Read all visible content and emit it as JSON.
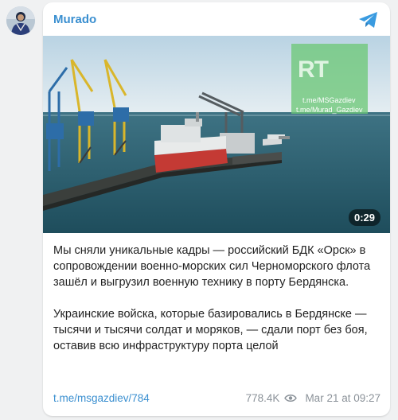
{
  "channel": {
    "name": "Murado",
    "accent_color": "#3a8fd0",
    "avatar_icon": "user-avatar-icon",
    "platform_icon": "telegram-icon"
  },
  "video": {
    "duration": "0:29",
    "watermark": {
      "logo": "RT",
      "line1": "t.me/MSGazdiev",
      "line2": "t.me/Murad_Gazdiev"
    }
  },
  "post": {
    "paragraphs": [
      "Мы сняли уникальные кадры — российский БДК «Орск» в сопровождении военно-морских сил Черноморского флота зашёл и выгрузил военную технику в порту Бердянска.",
      "Украинские войска, которые базировались в Бердянске — тысячи и тысячи солдат и моряков, — сдали порт без боя, оставив всю инфраструктуру порта целой"
    ],
    "link": "t.me/msgazdiev/784",
    "views": "778.4K",
    "views_icon": "eye-icon",
    "timestamp": "Mar 21 at 09:27"
  }
}
